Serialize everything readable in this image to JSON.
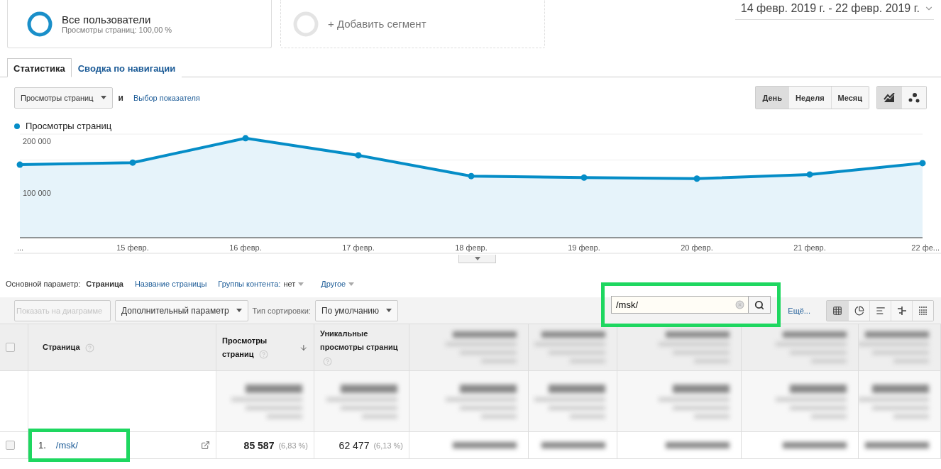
{
  "segments": [
    {
      "kind": "active",
      "title": "Все пользователи",
      "subtitle": "Просмотры страниц: 100,00 %"
    },
    {
      "kind": "add",
      "title": "+ Добавить сегмент"
    }
  ],
  "date_range": "14 февр. 2019 г. - 22 февр. 2019 г.",
  "tabs": [
    {
      "label": "Статистика",
      "selected": true
    },
    {
      "label": "Сводка по навигации",
      "selected": false
    }
  ],
  "metric_selector": {
    "value": "Просмотры страниц",
    "conjunction": "и",
    "link": "Выбор показателя"
  },
  "granularity": [
    {
      "label": "День",
      "selected": true
    },
    {
      "label": "Неделя",
      "selected": false
    },
    {
      "label": "Месяц",
      "selected": false
    }
  ],
  "chart_types": [
    {
      "kind": "line",
      "selected": true
    },
    {
      "kind": "motion",
      "selected": false
    }
  ],
  "chart": {
    "chart_data": {
      "type": "area",
      "categories": [
        "...",
        "15 февр.",
        "16 февр.",
        "17 февр.",
        "18 февр.",
        "19 февр.",
        "20 февр.",
        "21 февр.",
        "22 фе..."
      ],
      "series": [
        {
          "name": "Просмотры страниц",
          "color": "#058dc7",
          "values": [
            141000,
            145000,
            192000,
            159000,
            119000,
            116000,
            114000,
            122000,
            144000
          ]
        }
      ],
      "ylim": [
        0,
        200000
      ],
      "yticks": [
        {
          "value": 100000,
          "label": "100 000"
        },
        {
          "value": 200000,
          "label": "200 000"
        }
      ]
    }
  },
  "dimensions": {
    "label": "Основной параметр:",
    "items": [
      {
        "kind": "current",
        "label": "Страница"
      },
      {
        "kind": "link",
        "label": "Название страницы"
      },
      {
        "kind": "value",
        "label": "Группы контента:",
        "value": "нет"
      },
      {
        "kind": "menu",
        "label": "Другое"
      }
    ]
  },
  "toolbar": {
    "plot_button": {
      "label": "Показать на диаграмме",
      "disabled": true
    },
    "secondary": "Дополнительный параметр",
    "sort_label": "Тип сортировки:",
    "sort_value": "По умолчанию",
    "search": {
      "value": "/msk/"
    },
    "more_link": "Ещё...",
    "views": [
      {
        "kind": "table",
        "selected": true
      },
      {
        "kind": "pie",
        "selected": false
      },
      {
        "kind": "bar",
        "selected": false
      },
      {
        "kind": "compare",
        "selected": false
      },
      {
        "kind": "pivot",
        "selected": false
      }
    ]
  },
  "table": {
    "select_all_checked": false,
    "columns": [
      {
        "label": "Страница",
        "sorted": false
      },
      {
        "label": "Просмотры страниц",
        "sorted": true
      },
      {
        "label": "Уникальные просмотры страниц",
        "sorted": false
      }
    ],
    "rows": [
      {
        "checked": false,
        "highlighted": true,
        "cells": [
          {
            "index": "1.",
            "page": "/msk/"
          },
          {
            "value": "85 587",
            "share": "(6,83 %)",
            "bold": true
          },
          {
            "value": "62 477",
            "share": "(6,13 %)",
            "bold": false
          }
        ]
      }
    ]
  }
}
